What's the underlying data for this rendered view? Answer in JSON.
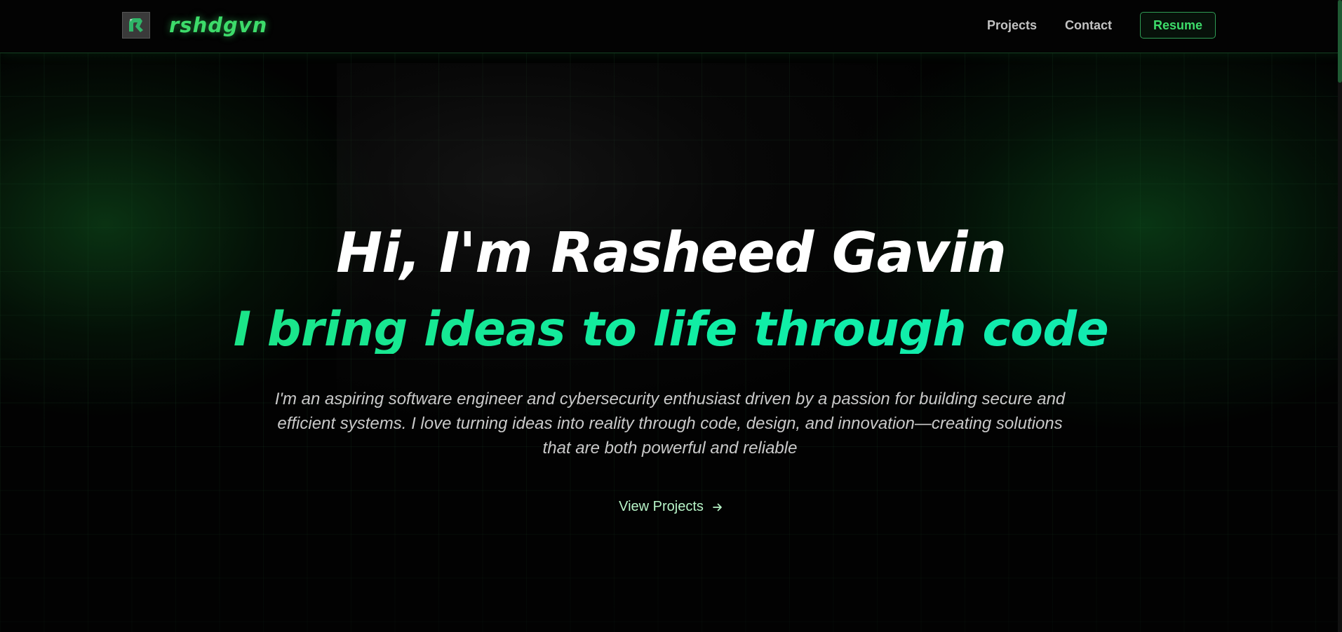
{
  "nav": {
    "brand": "rshdgvn",
    "links": [
      "Projects",
      "Contact"
    ],
    "resume_label": "Resume"
  },
  "hero": {
    "title": "Hi, I'm Rasheed Gavin",
    "subtitle": "I bring ideas to life through code",
    "description": "I'm an aspiring software engineer and cybersecurity enthusiast driven by a passion for building secure and efficient systems. I love turning ideas into reality through code, design, and innovation—creating solutions that are both powerful and reliable",
    "cta_label": "View Projects"
  },
  "icons": {
    "logo": "rg-logo-icon",
    "cta_arrow": "arrow-right-icon"
  },
  "colors": {
    "accent": "#3ddc6a",
    "subtitle_accent": "#12eda2",
    "background": "#020202",
    "cta_text": "#b8f5c8"
  }
}
